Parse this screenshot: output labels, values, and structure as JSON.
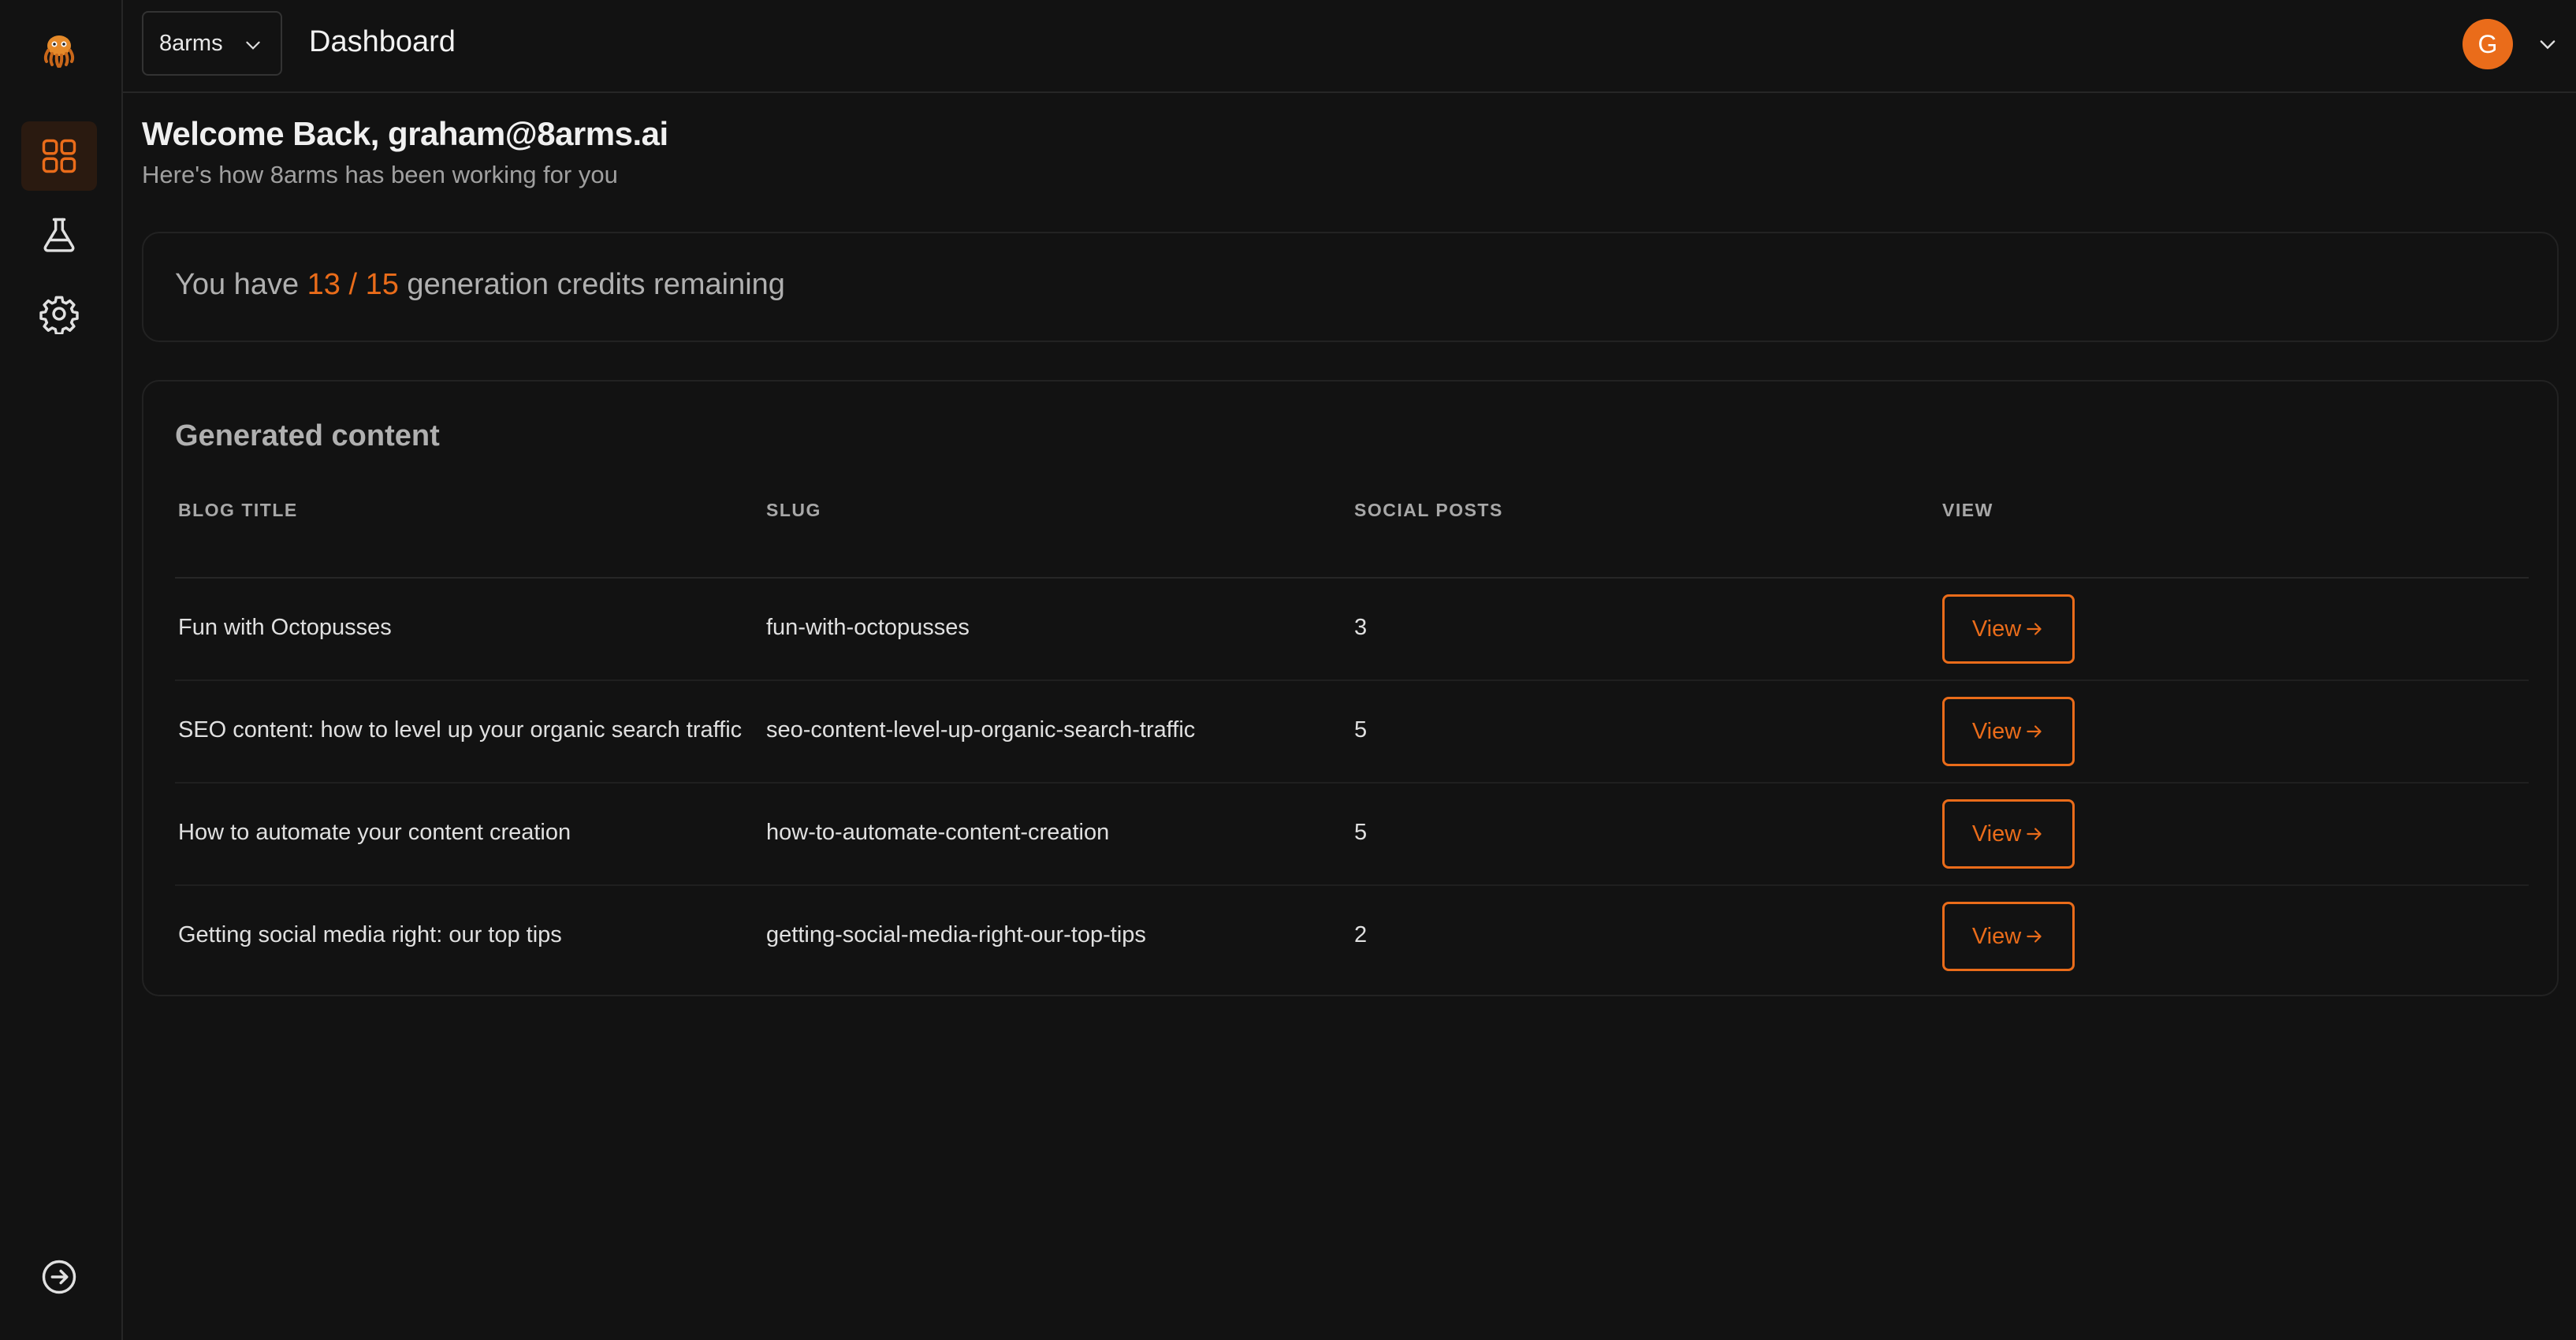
{
  "colors": {
    "accent": "#ea6c1a",
    "background": "#121212"
  },
  "sidebar": {
    "items": [
      {
        "icon": "dashboard-grid-icon",
        "active": true
      },
      {
        "icon": "flask-icon",
        "active": false
      },
      {
        "icon": "gear-icon",
        "active": false
      }
    ],
    "footer_icon": "logout-icon"
  },
  "header": {
    "org_name": "8arms",
    "page_title": "Dashboard",
    "avatar_initial": "G"
  },
  "welcome": {
    "title": "Welcome Back, graham@8arms.ai",
    "subtitle": "Here's how 8arms has been working for you"
  },
  "credits": {
    "prefix": "You have ",
    "used": "13 / 15",
    "suffix": " generation credits remaining"
  },
  "content": {
    "title": "Generated content",
    "columns": [
      "BLOG TITLE",
      "SLUG",
      "SOCIAL POSTS",
      "VIEW"
    ],
    "rows": [
      {
        "title": "Fun with Octopusses",
        "slug": "fun-with-octopusses",
        "social_posts": "3",
        "view_label": "View"
      },
      {
        "title": "SEO content: how to level up your organic search traffic",
        "slug": "seo-content-level-up-organic-search-traffic",
        "social_posts": "5",
        "view_label": "View"
      },
      {
        "title": "How to automate your content creation",
        "slug": "how-to-automate-content-creation",
        "social_posts": "5",
        "view_label": "View"
      },
      {
        "title": "Getting social media right: our top tips",
        "slug": "getting-social-media-right-our-top-tips",
        "social_posts": "2",
        "view_label": "View"
      }
    ]
  }
}
